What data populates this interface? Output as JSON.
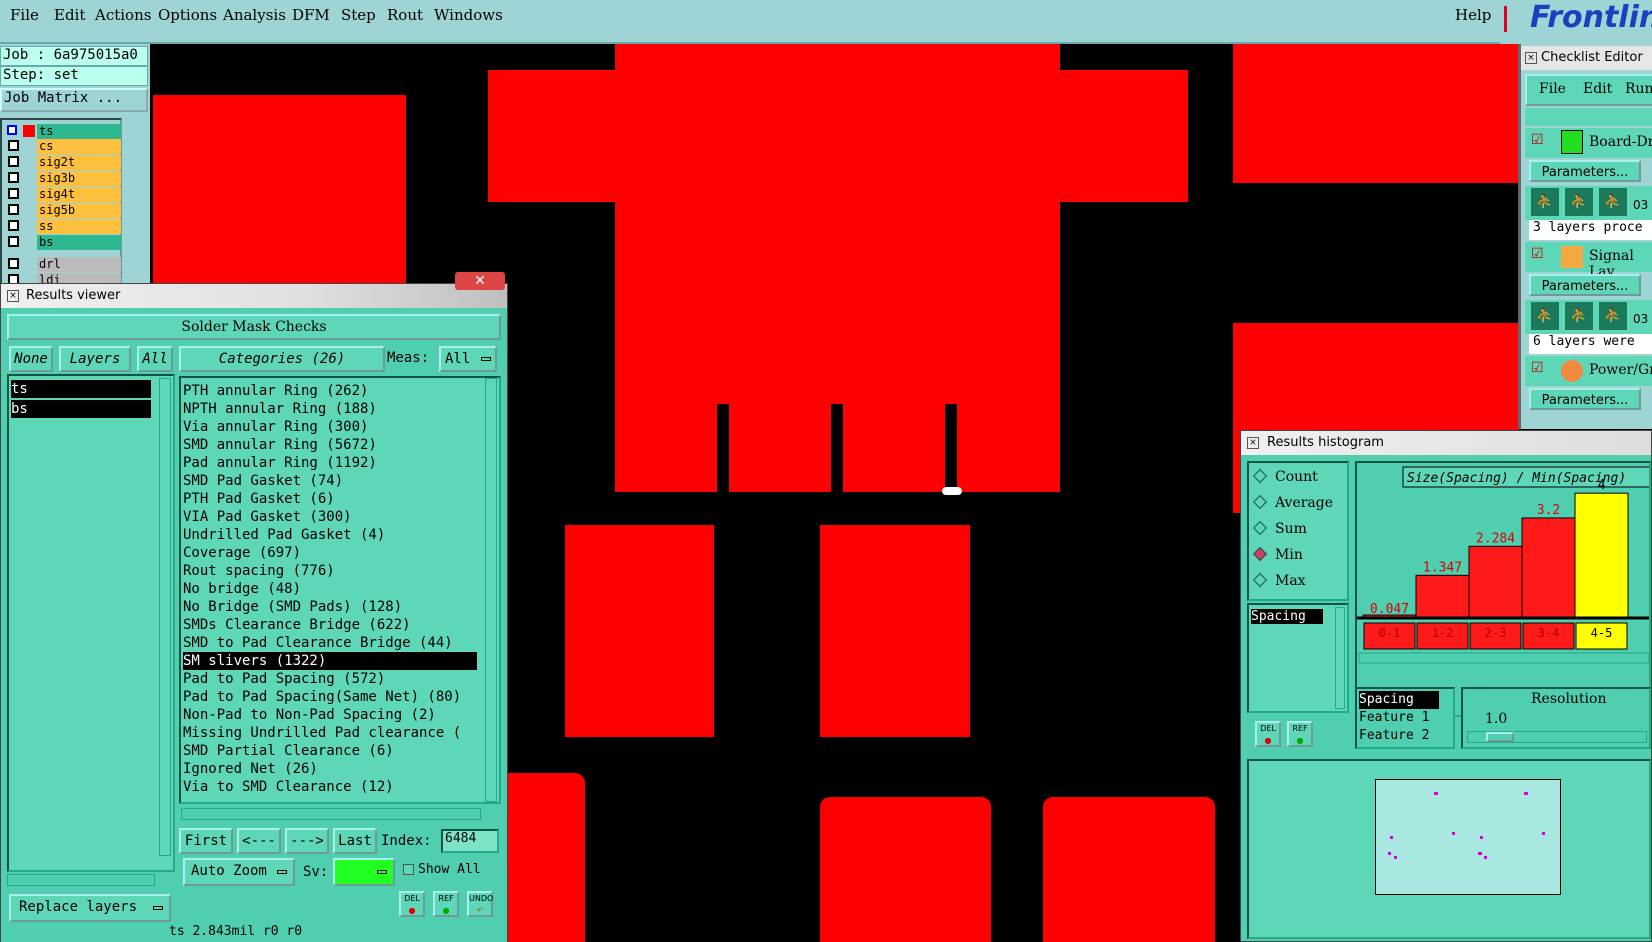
{
  "menu": {
    "items": [
      "File",
      "Edit",
      "Actions",
      "Options",
      "Analysis",
      "DFM",
      "Step",
      "Rout",
      "Windows"
    ],
    "help": "Help"
  },
  "logo": "Frontline",
  "job": {
    "job_label": "Job : 6a975015a0",
    "step_label": "Step: set",
    "matrix_button": "Job Matrix ..."
  },
  "layers": [
    "ts",
    "cs",
    "sig2t",
    "sig3b",
    "sig4t",
    "sig5b",
    "ss",
    "bs",
    "drl",
    "ldi"
  ],
  "results_viewer": {
    "title": "Results viewer",
    "heading": "Solder Mask Checks",
    "tabs": {
      "none": "None",
      "layers": "Layers",
      "all": "All"
    },
    "categories_button": "Categories (26)",
    "meas_label": "Meas:",
    "meas_value": "All",
    "layer_list": [
      "ts",
      "bs"
    ],
    "categories": [
      "PTH annular Ring (262)",
      "NPTH annular Ring (188)",
      "Via annular Ring (300)",
      "SMD annular Ring (5672)",
      "Pad annular Ring (1192)",
      "SMD Pad Gasket (74)",
      "PTH Pad Gasket (6)",
      "VIA Pad Gasket (300)",
      "Undrilled Pad Gasket (4)",
      "Coverage (697)",
      "Rout spacing (776)",
      "No bridge (48)",
      "No Bridge (SMD Pads) (128)",
      "SMDs Clearance Bridge (622)",
      "SMD to Pad Clearance Bridge (44)",
      "SM slivers (1322)",
      "Pad to Pad Spacing (572)",
      "Pad to Pad Spacing(Same Net) (80)",
      "Non-Pad to Non-Pad Spacing (2)",
      "Missing Undrilled Pad clearance (",
      "SMD Partial Clearance (6)",
      "Ignored Net (26)",
      "Via to SMD Clearance (12)"
    ],
    "selected_index": 15,
    "nav": {
      "first": "First",
      "prev": "<---",
      "next": "--->",
      "last": "Last",
      "index_label": "Index:",
      "index_value": "6484"
    },
    "auto_zoom": "Auto Zoom",
    "sv_label": "Sv:",
    "show_all": "Show All",
    "replace_layers": "Replace layers",
    "icons": {
      "del": "DEL",
      "ref": "REF",
      "undo": "UNDO"
    }
  },
  "status_bar": "ts 2.843mil  r0  r0",
  "checklist": {
    "title": "Checklist Editor",
    "menu": [
      "File",
      "Edit",
      "Run"
    ],
    "items": [
      {
        "name": "Board-Dr",
        "params": "Parameters...",
        "count": "03",
        "status": "3 layers proce"
      },
      {
        "name": "Signal Lay",
        "params": "Parameters...",
        "count": "03",
        "status": "6 layers were"
      },
      {
        "name": "Power/Gro",
        "params": "Parameters..."
      }
    ]
  },
  "histogram": {
    "title": "Results histogram",
    "modes": [
      "Count",
      "Average",
      "Sum",
      "Min",
      "Max"
    ],
    "selected_mode": "Min",
    "field": "Spacing",
    "chart_title": "Size(Spacing) / Min(Spacing)",
    "fields": [
      "Spacing",
      "Feature 1",
      "Feature 2"
    ],
    "resolution_label": "Resolution",
    "resolution_value": "1.0",
    "icons": {
      "del": "DEL",
      "ref": "REF"
    }
  },
  "chart_data": {
    "type": "bar",
    "title": "Size(Spacing) / Min(Spacing)",
    "categories": [
      "0-1",
      "1-2",
      "2-3",
      "3-4",
      "4-5"
    ],
    "values": [
      0.047,
      1.347,
      2.284,
      3.2,
      4
    ],
    "value_labels": [
      "0.047",
      "1.347",
      "2.284",
      "3.2",
      "4"
    ],
    "colors": [
      "#ff1a1a",
      "#ff1a1a",
      "#ff1a1a",
      "#ff1a1a",
      "#ffff00"
    ],
    "ylim": [
      0,
      4.2
    ]
  },
  "colors": {
    "panel": "#4fcfb0",
    "menubar": "#9ed4d4",
    "copper": "#ff0000",
    "highlight": "#ffff00"
  }
}
